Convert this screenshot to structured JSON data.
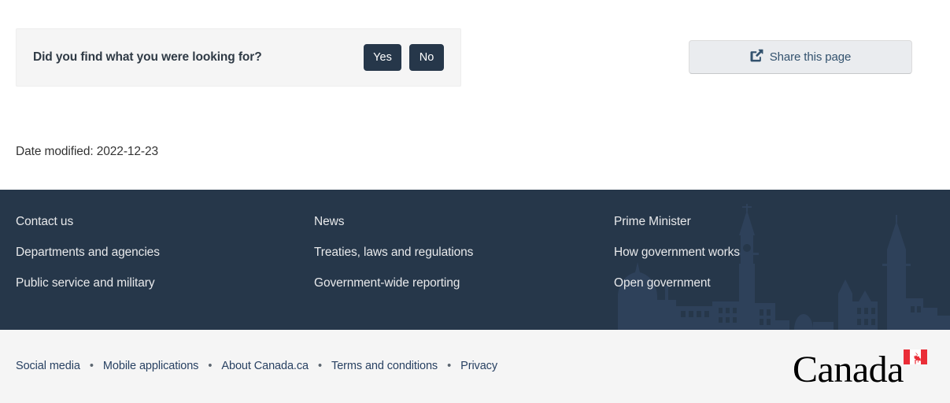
{
  "feedback": {
    "question": "Did you find what you were looking for?",
    "yes_label": "Yes",
    "no_label": "No"
  },
  "share": {
    "label": "Share this page",
    "icon": "share-square-icon"
  },
  "date_modified": "Date modified: 2022-12-23",
  "footer": {
    "columns": [
      {
        "links": [
          "Contact us",
          "Departments and agencies",
          "Public service and military"
        ]
      },
      {
        "links": [
          "News",
          "Treaties, laws and regulations",
          "Government-wide reporting"
        ]
      },
      {
        "links": [
          "Prime Minister",
          "How government works",
          "Open government"
        ]
      }
    ],
    "watermark": "parliament-hill-silhouette"
  },
  "bottom_bar": {
    "links": [
      "Social media",
      "Mobile applications",
      "About Canada.ca",
      "Terms and conditions",
      "Privacy"
    ],
    "separator": "•",
    "wordmark": "Canada",
    "wordmark_flag": "canadian-flag-icon"
  },
  "colors": {
    "footer_navy": "#26374a",
    "bottom_bar_bg": "#f5f5f5",
    "link_blue": "#284162",
    "share_text": "#33526e",
    "flag_red": "#ea2d37"
  }
}
